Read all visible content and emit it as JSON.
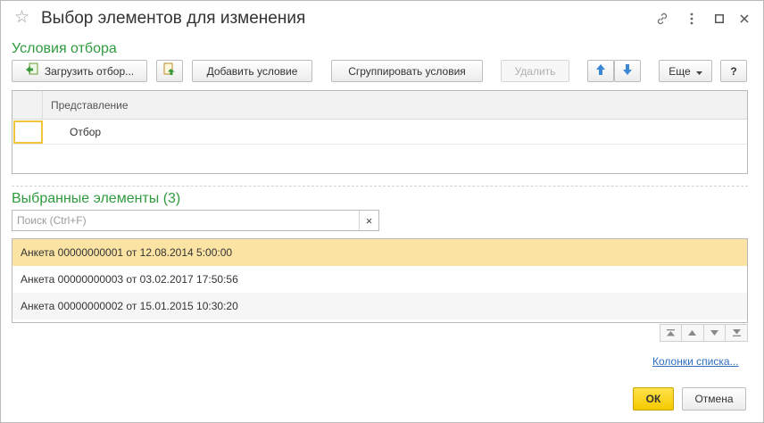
{
  "window": {
    "title": "Выбор элементов для изменения"
  },
  "filter": {
    "section_title": "Условия отбора",
    "toolbar": {
      "load_label": "Загрузить отбор...",
      "add_label": "Добавить условие",
      "group_label": "Сгруппировать условия",
      "delete_label": "Удалить",
      "more_label": "Еще",
      "help_label": "?"
    },
    "grid": {
      "column_header": "Представление",
      "rows": [
        "Отбор"
      ]
    }
  },
  "selected": {
    "section_title": "Выбранные элементы (3)",
    "search_placeholder": "Поиск (Ctrl+F)",
    "search_value": "",
    "clear_label": "×",
    "items": [
      "Анкета 00000000001 от 12.08.2014 5:00:00",
      "Анкета 00000000003 от 03.02.2017 17:50:56",
      "Анкета 00000000002 от 15.01.2015 10:30:20"
    ],
    "columns_link": "Колонки списка..."
  },
  "footer": {
    "ok_label": "ОК",
    "cancel_label": "Отмена"
  },
  "colors": {
    "accent_green": "#2f9a3e",
    "selection": "#fbe3a4",
    "ok_button": "#f5c900",
    "link": "#2e6ec2"
  },
  "icons": {
    "title_star": "star-icon",
    "link": "link-icon",
    "more": "more-vertical-icon",
    "maximize": "maximize-icon",
    "close": "close-icon",
    "load_filter": "load-filter-icon",
    "save_filter": "save-filter-icon",
    "move_up": "arrow-up-icon",
    "move_down": "arrow-down-icon",
    "nav_first": "first-icon",
    "nav_prev": "prev-icon",
    "nav_next": "next-icon",
    "nav_last": "last-icon"
  }
}
